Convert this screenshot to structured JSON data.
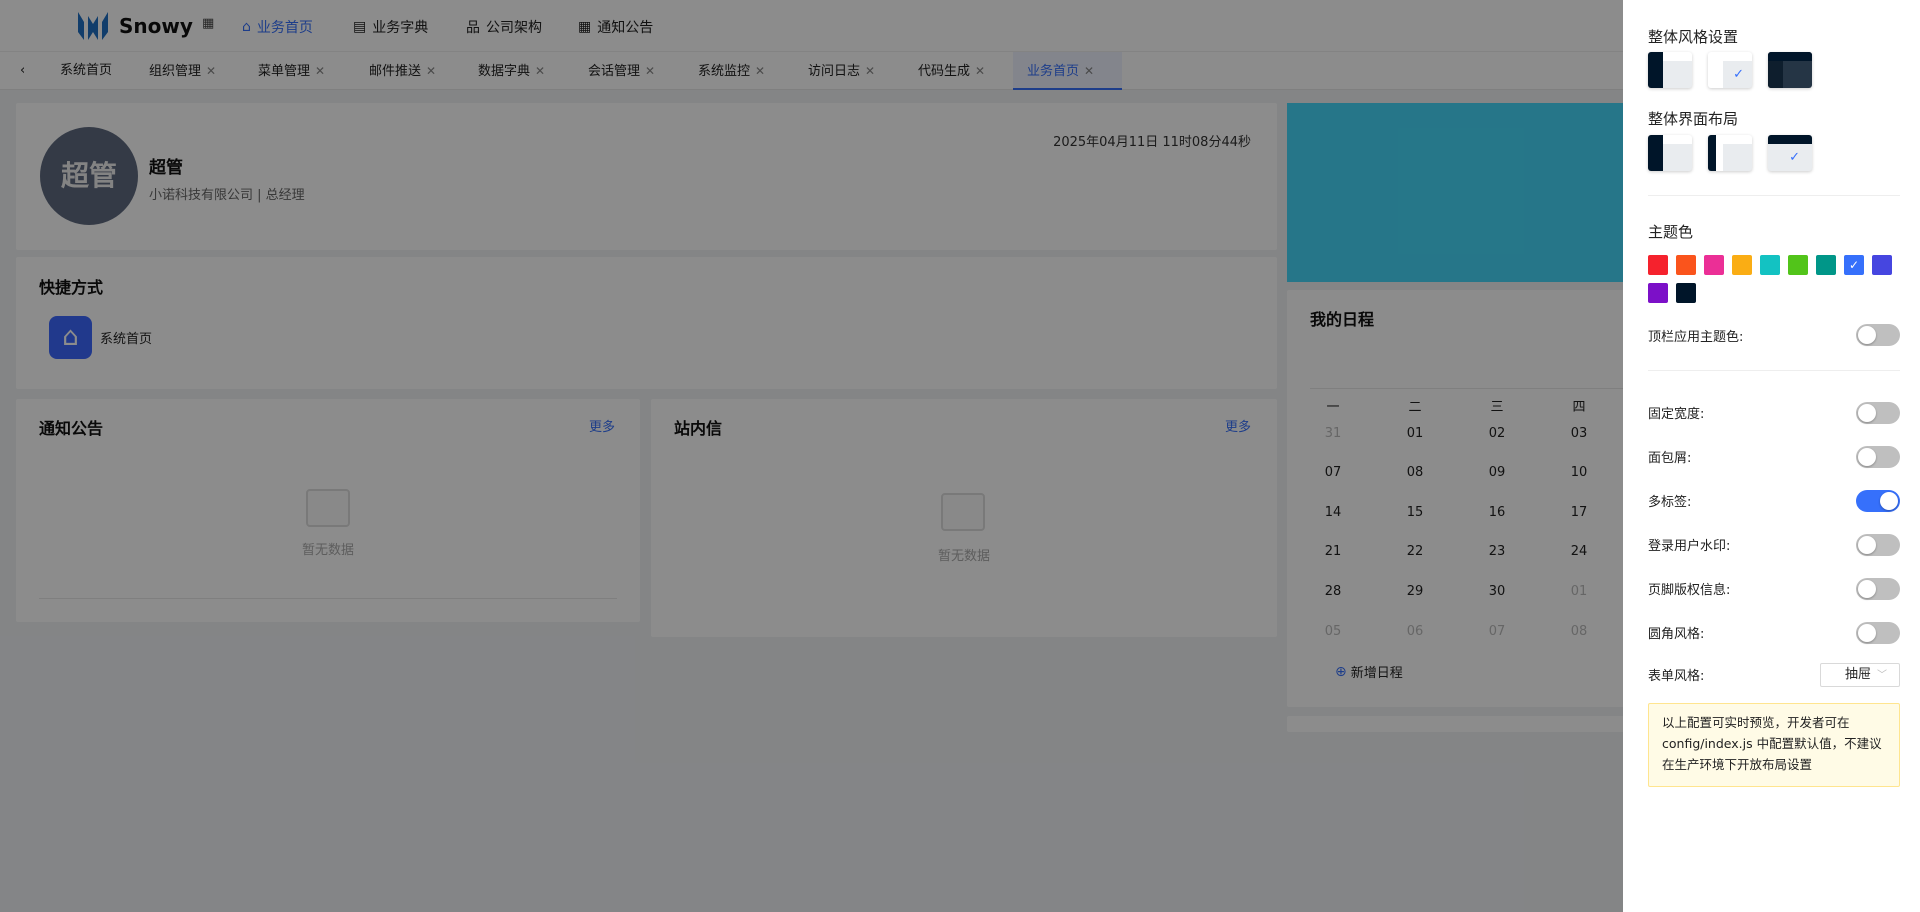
{
  "header": {
    "brand": "Snowy",
    "menu": [
      {
        "label": "业务首页",
        "icon": "home-icon",
        "active": true
      },
      {
        "label": "业务字典",
        "icon": "book-icon"
      },
      {
        "label": "公司架构",
        "icon": "org-icon"
      },
      {
        "label": "通知公告",
        "icon": "grid-icon"
      }
    ]
  },
  "tabs": [
    "系统首页",
    "组织管理",
    "菜单管理",
    "邮件推送",
    "数据字典",
    "会话管理",
    "系统监控",
    "访问日志",
    "代码生成",
    "业务首页"
  ],
  "profile": {
    "avatar_text": "超管",
    "name": "超管",
    "subtitle": "小诺科技有限公司 | 总经理",
    "datetime": "2025年04月11日 11时08分44秒"
  },
  "shortcuts": {
    "title": "快捷方式",
    "items": [
      {
        "label": "系统首页",
        "icon": "home-icon"
      }
    ]
  },
  "notice": {
    "title": "通知公告",
    "more": "更多",
    "empty": "暂无数据"
  },
  "messages": {
    "title": "站内信",
    "more": "更多",
    "empty": "暂无数据"
  },
  "schedule": {
    "title": "我的日程",
    "weekdays": [
      "一",
      "二",
      "三",
      "四"
    ],
    "rows": [
      [
        "31",
        "01",
        "02",
        "03"
      ],
      [
        "07",
        "08",
        "09",
        "10"
      ],
      [
        "14",
        "15",
        "16",
        "17"
      ],
      [
        "21",
        "22",
        "23",
        "24"
      ],
      [
        "28",
        "29",
        "30",
        "01"
      ],
      [
        "05",
        "06",
        "07",
        "08"
      ]
    ],
    "muted": [
      [
        true,
        false,
        false,
        false
      ],
      [
        false,
        false,
        false,
        false
      ],
      [
        false,
        false,
        false,
        false
      ],
      [
        false,
        false,
        false,
        false
      ],
      [
        false,
        false,
        false,
        true
      ],
      [
        true,
        true,
        true,
        true
      ]
    ],
    "add_label": "新增日程"
  },
  "drawer": {
    "style_title": "整体风格设置",
    "layout_title": "整体界面布局",
    "theme_title": "主题色",
    "theme_colors": [
      "#f5222d",
      "#fa541c",
      "#eb2f96",
      "#faad14",
      "#13c2c2",
      "#52c41a",
      "#009688",
      "#3670fb",
      "#4646e0",
      "#7c10c8",
      "#001529"
    ],
    "selected_color": "#3670fb",
    "top_theme_label": "顶栏应用主题色:",
    "top_theme_on": false,
    "toggles": [
      {
        "label": "固定宽度:",
        "on": false
      },
      {
        "label": "面包屑:",
        "on": false
      },
      {
        "label": "多标签:",
        "on": true
      },
      {
        "label": "登录用户水印:",
        "on": false
      },
      {
        "label": "页脚版权信息:",
        "on": false
      },
      {
        "label": "圆角风格:",
        "on": false
      }
    ],
    "form_style_label": "表单风格:",
    "form_style_value": "抽屉",
    "note": "以上配置可实时预览，开发者可在 config/index.js 中配置默认值，不建议在生产环境下开放布局设置"
  }
}
